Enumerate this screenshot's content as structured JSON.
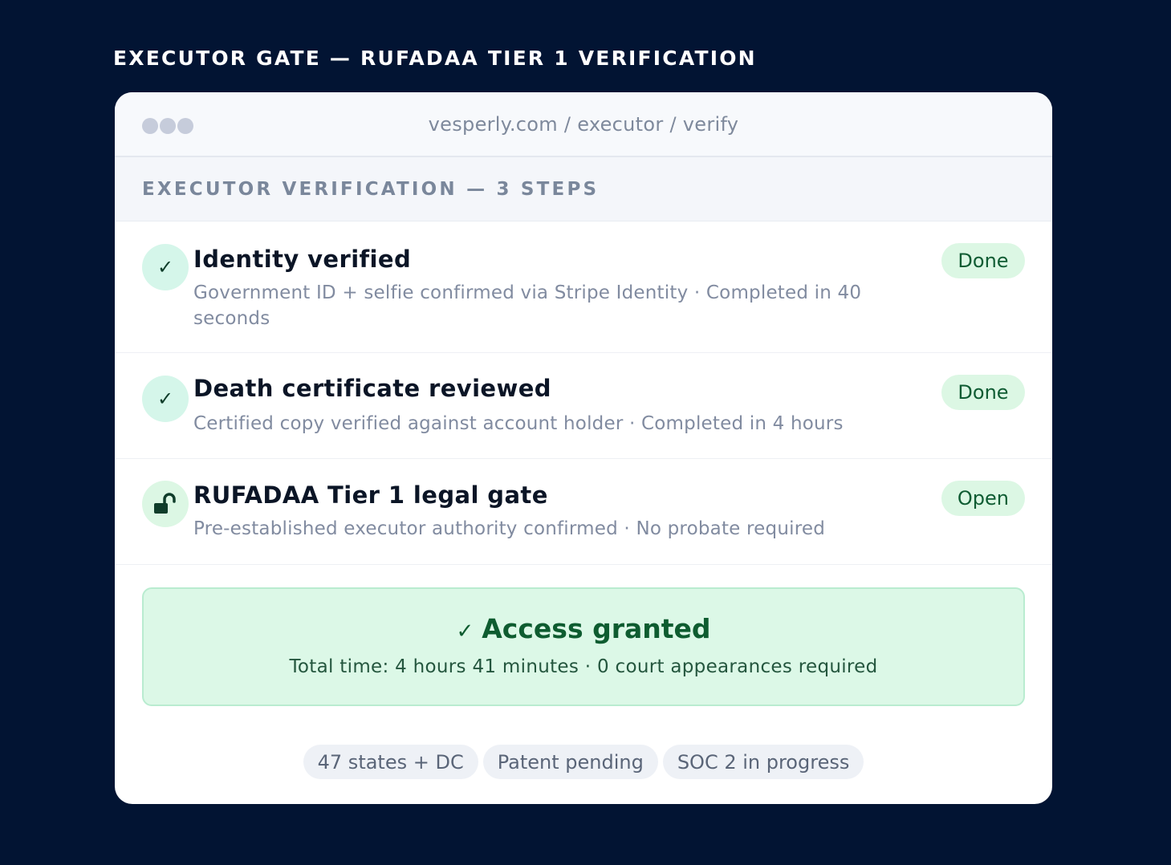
{
  "page_heading": "EXECUTOR GATE — RUFADAA TIER 1 VERIFICATION",
  "window": {
    "url": "vesperly.com / executor / verify"
  },
  "section": {
    "title": "EXECUTOR VERIFICATION — 3 STEPS"
  },
  "steps": [
    {
      "icon": "check-icon",
      "icon_glyph": "✓",
      "title": "Identity verified",
      "description": "Government ID + selfie confirmed via Stripe Identity · Completed in 40 seconds",
      "status": "Done"
    },
    {
      "icon": "check-icon",
      "icon_glyph": "✓",
      "title": "Death certificate reviewed",
      "description": "Certified copy verified against account holder · Completed in 4 hours",
      "status": "Done"
    },
    {
      "icon": "unlock-icon",
      "title": "RUFADAA Tier 1 legal gate",
      "description": "Pre-established executor authority confirmed · No probate required",
      "status": "Open"
    }
  ],
  "access": {
    "icon_glyph": "✓",
    "title": "Access granted",
    "subtitle": "Total time: 4 hours 41 minutes · 0 court appearances required"
  },
  "tags": [
    "47 states + DC",
    "Patent pending",
    "SOC 2 in progress"
  ],
  "colors": {
    "background": "#021433",
    "success_bg": "#dcf8e7",
    "success_text": "#0e5c30"
  }
}
